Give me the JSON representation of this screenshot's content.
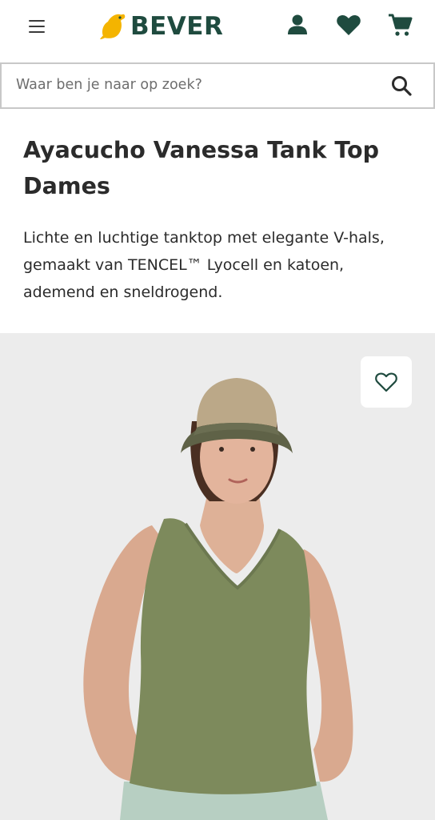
{
  "header": {
    "logo_text": "BEVER",
    "brand_color": "#1f4b3f",
    "logo_accent_color": "#f4b400",
    "icons": [
      "menu-icon",
      "account-icon",
      "heart-icon",
      "cart-icon"
    ]
  },
  "search": {
    "placeholder": "Waar ben je naar op zoek?",
    "icon": "search-icon"
  },
  "product": {
    "brand": "Ayacucho",
    "name": " Vanessa Tank Top Dames",
    "description": "Lichte en luchtige tanktop met elegante V-hals, gemaakt van TENCEL™ Lyocell en katoen, ademend en sneldrogend.",
    "image_favorite_icon": "heart-outline-icon"
  }
}
